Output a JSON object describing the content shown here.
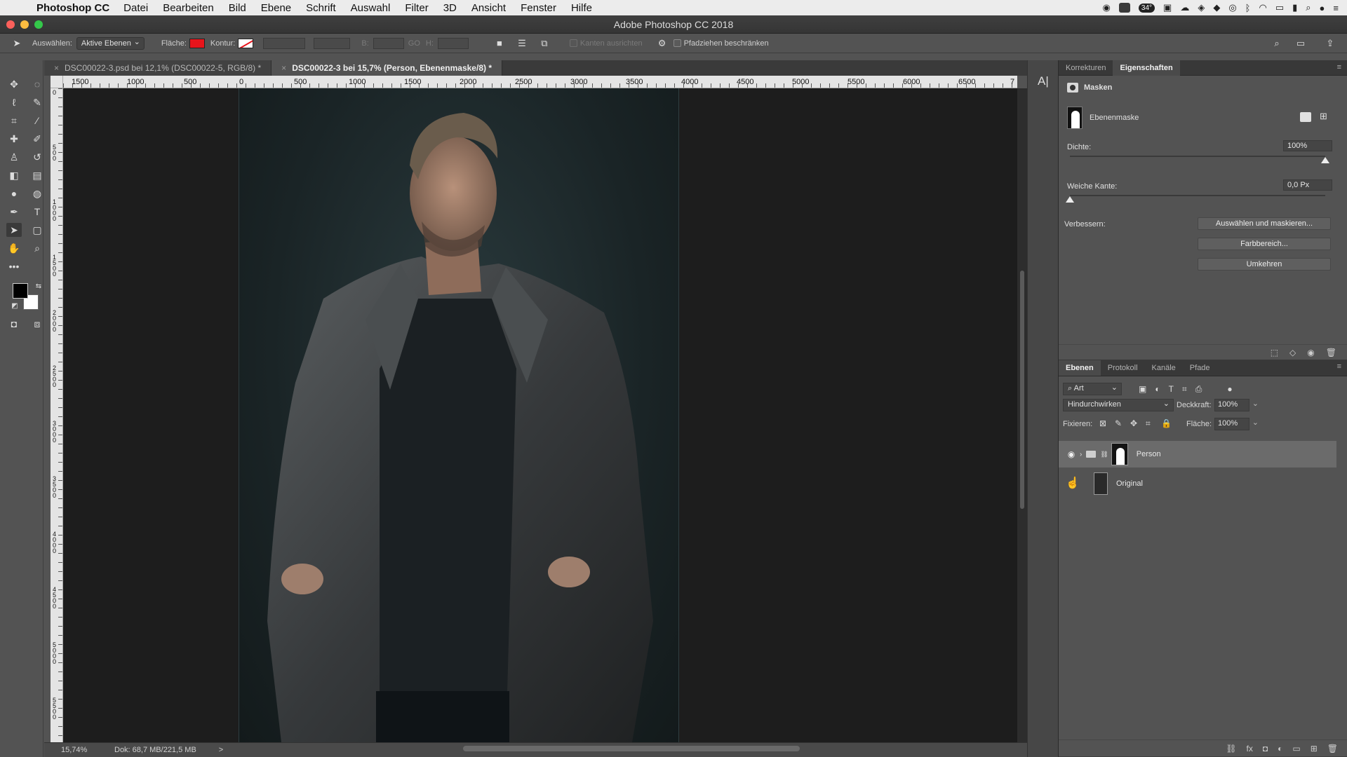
{
  "menubar": {
    "app_name": "Photoshop CC",
    "items": [
      "Datei",
      "Bearbeiten",
      "Bild",
      "Ebene",
      "Schrift",
      "Auswahl",
      "Filter",
      "3D",
      "Ansicht",
      "Fenster",
      "Hilfe"
    ],
    "status_temp": "34°"
  },
  "window": {
    "title": "Adobe Photoshop CC 2018"
  },
  "options": {
    "select_label": "Auswählen:",
    "select_value": "Aktive Ebenen",
    "fill_label": "Fläche:",
    "fill_color": "#e8141b",
    "stroke_label": "Kontur:",
    "w_label": "B:",
    "link_label": "GO",
    "h_label": "H:",
    "align_edges": "Kanten ausrichten",
    "constrain_paths": "Pfadziehen beschränken"
  },
  "tabs": [
    {
      "label": "DSC00022-3.psd bei 12,1% (DSC00022-5, RGB/8) *",
      "active": false
    },
    {
      "label": "DSC00022-3 bei 15,7% (Person, Ebenenmaske/8) *",
      "active": true
    }
  ],
  "ruler": {
    "h_labels": [
      "1500",
      "1000",
      "500",
      "0",
      "500",
      "1000",
      "1500",
      "2000",
      "2500",
      "3000",
      "3500",
      "4000",
      "4500",
      "5000",
      "5500",
      "6000",
      "6500",
      "7"
    ],
    "v_labels": [
      "0",
      "5 0 0",
      "1 0 0 0",
      "1 5 0 0",
      "2 0 0 0",
      "2 5 0 0",
      "3 0 0 0",
      "3 5 0 0",
      "4 0 0 0",
      "4 5 0 0",
      "5 0 0 0",
      "5 5 0 0"
    ]
  },
  "status": {
    "zoom": "15,74%",
    "doc": "Dok: 68,7 MB/221,5 MB",
    "arrow": ">"
  },
  "properties": {
    "tabs": [
      "Korrekturen",
      "Eigenschaften"
    ],
    "active_tab": "Eigenschaften",
    "section": "Masken",
    "mask_type": "Ebenenmaske",
    "density_label": "Dichte:",
    "density_value": "100%",
    "density_level": 1.0,
    "feather_label": "Weiche Kante:",
    "feather_value": "0,0 Px",
    "feather_level": 0.0,
    "refine_label": "Verbessern:",
    "btn_select_mask": "Auswählen und maskieren...",
    "btn_color_range": "Farbbereich...",
    "btn_invert": "Umkehren"
  },
  "layers": {
    "tabs": [
      "Ebenen",
      "Protokoll",
      "Kanäle",
      "Pfade"
    ],
    "active_tab": "Ebenen",
    "kind_filter": "Art",
    "blend_mode": "Hindurchwirken",
    "opacity_label": "Deckkraft:",
    "opacity_value": "100%",
    "lock_label": "Fixieren:",
    "fill_label": "Fläche:",
    "fill_value": "100%",
    "items": [
      {
        "name": "Person",
        "type": "group",
        "visible": true,
        "selected": true
      },
      {
        "name": "Original",
        "type": "smart-object",
        "visible": false,
        "selected": false
      }
    ]
  }
}
